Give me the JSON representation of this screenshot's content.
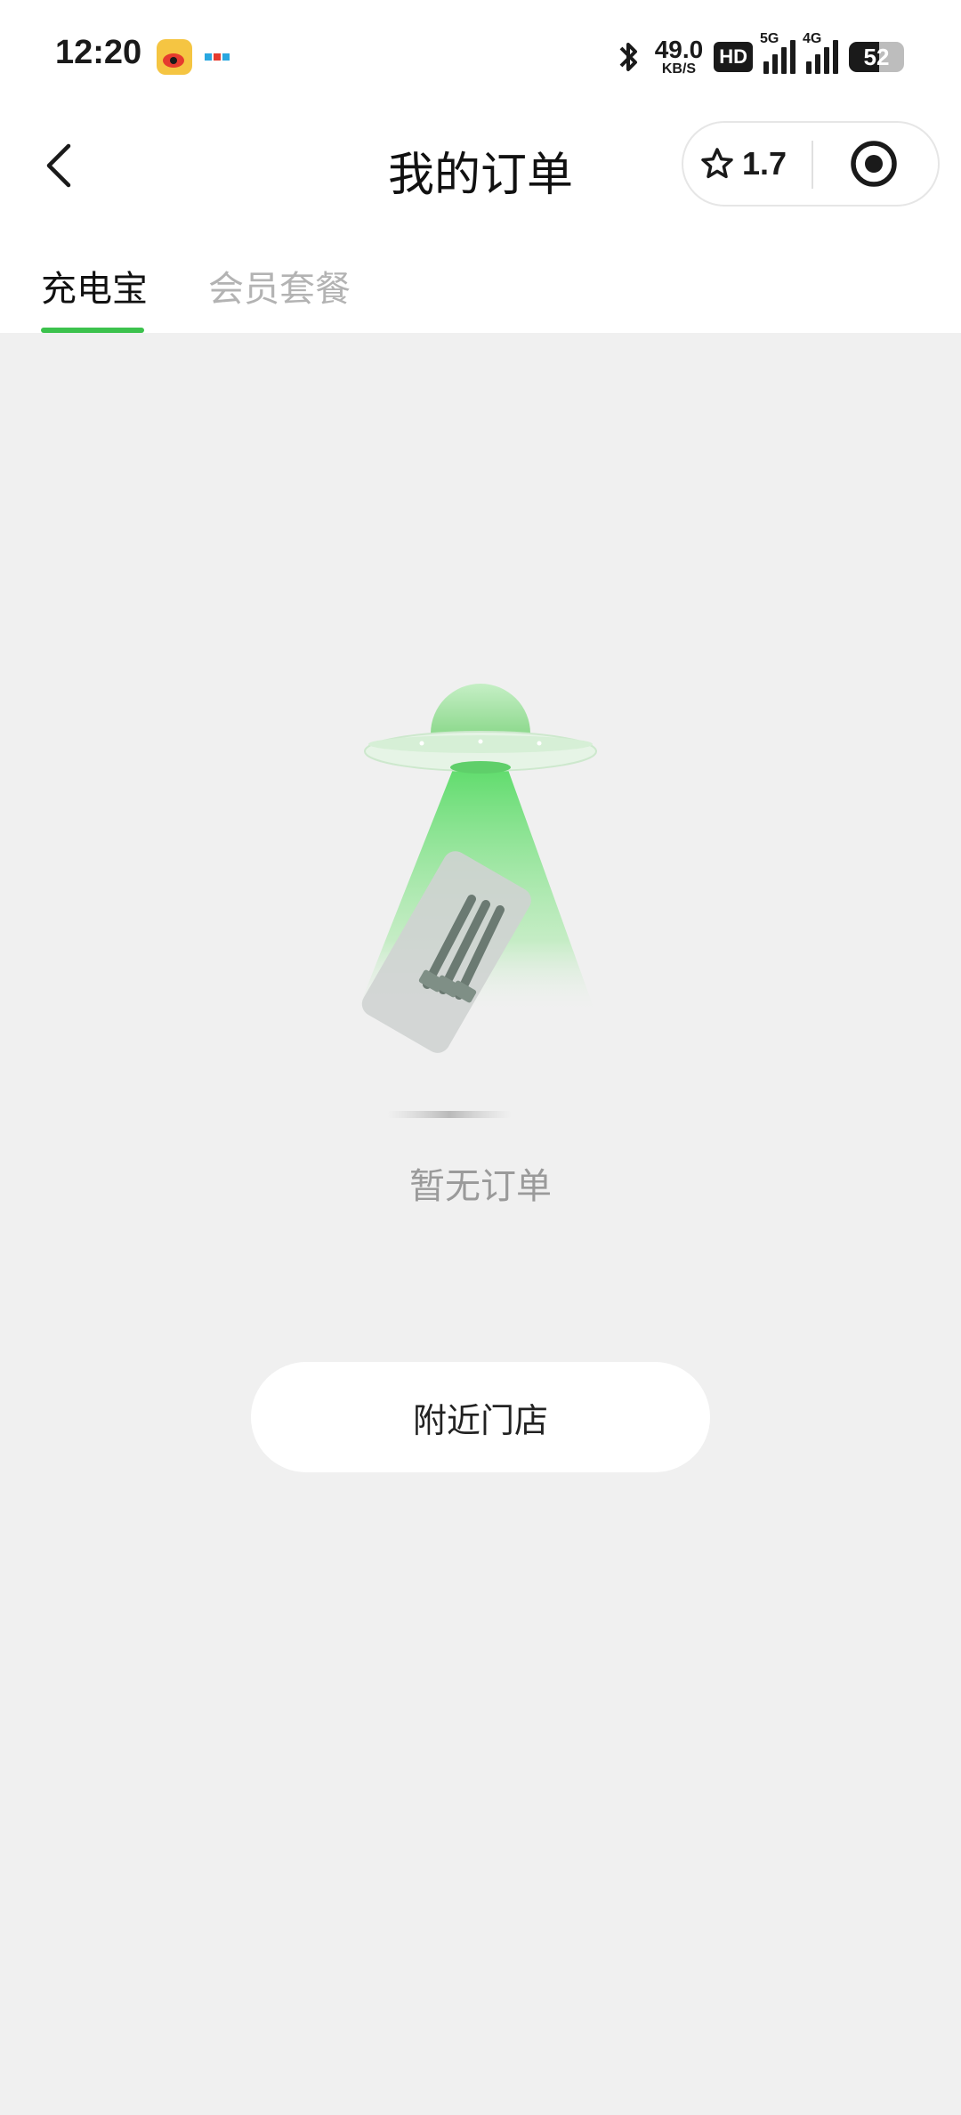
{
  "status_bar": {
    "time": "12:20",
    "net_speed_value": "49.0",
    "net_speed_unit": "KB/S",
    "hd_label": "HD",
    "signal1_label": "5G",
    "signal2_label": "4G",
    "battery_level": "52",
    "icons": [
      "weibo-icon",
      "tencent-icon",
      "bluetooth-icon",
      "signal-icon",
      "battery-icon"
    ]
  },
  "nav": {
    "title": "我的订单",
    "rating": "1.7",
    "icons": [
      "back-arrow-icon",
      "star-icon",
      "target-icon"
    ]
  },
  "tabs": [
    {
      "label": "充电宝",
      "active": true
    },
    {
      "label": "会员套餐",
      "active": false
    }
  ],
  "empty_state": {
    "text": "暂无订单",
    "illustration": "ufo-powerbank-illustration"
  },
  "actions": {
    "nearby_label": "附近门店"
  },
  "colors": {
    "accent": "#3cc24d",
    "background": "#f0f0f0"
  }
}
